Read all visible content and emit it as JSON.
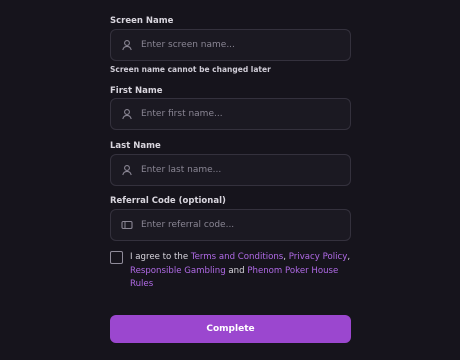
{
  "screen_name": {
    "label": "Screen Name",
    "placeholder": "Enter screen name...",
    "hint": "Screen name cannot be changed later"
  },
  "first_name": {
    "label": "First Name",
    "placeholder": "Enter first name..."
  },
  "last_name": {
    "label": "Last Name",
    "placeholder": "Enter last name..."
  },
  "referral": {
    "label": "Referral Code (optional)",
    "placeholder": "Enter referral code..."
  },
  "agreement": {
    "prefix": "I agree to the ",
    "terms_link": "Terms and Conditions",
    "sep1": ", ",
    "privacy_link": "Privacy Policy",
    "sep2": ", ",
    "gambling_link": "Responsible Gambling",
    "and": " and ",
    "rules_link": "Phenom Poker House Rules"
  },
  "submit_label": "Complete",
  "colors": {
    "background": "#16141c",
    "accent": "#9b47cf",
    "link": "#b06ae6"
  }
}
